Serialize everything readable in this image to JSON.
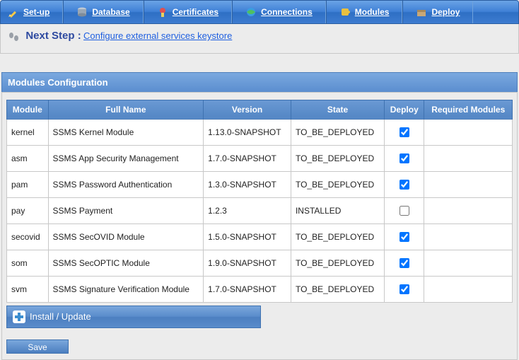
{
  "nav": {
    "items": [
      {
        "label": "Set-up",
        "icon": "pencil-icon"
      },
      {
        "label": "Database",
        "icon": "database-icon"
      },
      {
        "label": "Certificates",
        "icon": "certificate-icon"
      },
      {
        "label": "Connections",
        "icon": "globe-icon"
      },
      {
        "label": "Modules",
        "icon": "puzzle-icon"
      },
      {
        "label": "Deploy",
        "icon": "box-icon"
      }
    ]
  },
  "next_step": {
    "label": "Next Step :",
    "link_text": "Configure external services keystore"
  },
  "panel": {
    "title": "Modules Configuration"
  },
  "table": {
    "headers": {
      "module": "Module",
      "full_name": "Full Name",
      "version": "Version",
      "state": "State",
      "deploy": "Deploy",
      "required": "Required Modules"
    },
    "rows": [
      {
        "module": "kernel",
        "full_name": "SSMS Kernel Module",
        "version": "1.13.0-SNAPSHOT",
        "state": "TO_BE_DEPLOYED",
        "deploy": true,
        "required": ""
      },
      {
        "module": "asm",
        "full_name": "SSMS App Security Management",
        "version": "1.7.0-SNAPSHOT",
        "state": "TO_BE_DEPLOYED",
        "deploy": true,
        "required": ""
      },
      {
        "module": "pam",
        "full_name": "SSMS Password Authentication",
        "version": "1.3.0-SNAPSHOT",
        "state": "TO_BE_DEPLOYED",
        "deploy": true,
        "required": ""
      },
      {
        "module": "pay",
        "full_name": "SSMS Payment",
        "version": "1.2.3",
        "state": "INSTALLED",
        "deploy": false,
        "required": ""
      },
      {
        "module": "secovid",
        "full_name": "SSMS SecOVID Module",
        "version": "1.5.0-SNAPSHOT",
        "state": "TO_BE_DEPLOYED",
        "deploy": true,
        "required": ""
      },
      {
        "module": "som",
        "full_name": "SSMS SecOPTIC Module",
        "version": "1.9.0-SNAPSHOT",
        "state": "TO_BE_DEPLOYED",
        "deploy": true,
        "required": ""
      },
      {
        "module": "svm",
        "full_name": "SSMS Signature Verification Module",
        "version": "1.7.0-SNAPSHOT",
        "state": "TO_BE_DEPLOYED",
        "deploy": true,
        "required": ""
      }
    ]
  },
  "buttons": {
    "install_update": "Install / Update",
    "save": "Save"
  }
}
